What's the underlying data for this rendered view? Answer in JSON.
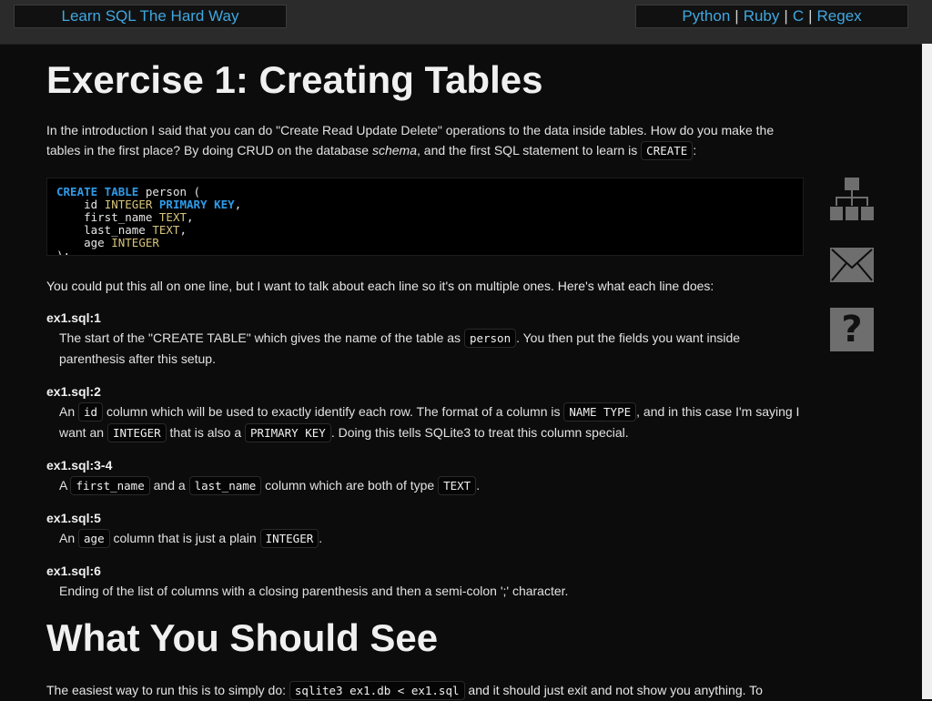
{
  "nav": {
    "title": "Learn SQL The Hard Way",
    "links": [
      "Python",
      "Ruby",
      "C",
      "Regex"
    ],
    "separator": "|"
  },
  "page": {
    "h1": "Exercise 1: Creating Tables",
    "intro_a": "In the introduction I said that you can do \"Create Read Update Delete\" operations to the data inside tables. How do you make the tables in the first place? By doing CRUD on the database ",
    "intro_em": "schema",
    "intro_b": ", and the first SQL statement to learn is ",
    "intro_code": "CREATE",
    "intro_c": ":",
    "code": {
      "l1_kw": "CREATE TABLE",
      "l1_rest": " person (",
      "l2_a": "    id ",
      "l2_ty": "INTEGER",
      "l2_kw": "PRIMARY KEY",
      "l2_end": ",",
      "l3_a": "    first_name ",
      "l3_ty": "TEXT",
      "l3_end": ",",
      "l4_a": "    last_name ",
      "l4_ty": "TEXT",
      "l4_end": ",",
      "l5_a": "    age ",
      "l5_ty": "INTEGER",
      "l6": ");"
    },
    "lead": "You could put this all on one line, but I want to talk about each line so it's on multiple ones. Here's what each line does:",
    "items": [
      {
        "term": "ex1.sql:1",
        "p1": "The start of the \"CREATE TABLE\" which gives the name of the table as ",
        "c1": "person",
        "p2": ". You then put the fields you want inside parenthesis after this setup."
      },
      {
        "term": "ex1.sql:2",
        "p1": "An ",
        "c1": "id",
        "p2": " column which will be used to exactly identify each row. The format of a column is ",
        "c2": "NAME TYPE",
        "p3": ", and in this case I'm saying I want an ",
        "c3": "INTEGER",
        "p4": " that is also a ",
        "c4": "PRIMARY KEY",
        "p5": ". Doing this tells SQLite3 to treat this column special."
      },
      {
        "term": "ex1.sql:3-4",
        "p1": "A ",
        "c1": "first_name",
        "p2": " and a ",
        "c2": "last_name",
        "p3": " column which are both of type ",
        "c3": "TEXT",
        "p4": "."
      },
      {
        "term": "ex1.sql:5",
        "p1": "An ",
        "c1": "age",
        "p2": " column that is just a plain ",
        "c2": "INTEGER",
        "p3": "."
      },
      {
        "term": "ex1.sql:6",
        "p1": "Ending of the list of columns with a closing parenthesis and then a semi-colon ';' character."
      }
    ],
    "h2": "What You Should See",
    "bottom_a": "The easiest way to run this is to simply do: ",
    "bottom_code1": "sqlite3 ex1.db < ex1.sql",
    "bottom_b": " and it should just exit and not show you anything. To"
  },
  "sidebar": {
    "icons": [
      "sitemap-icon",
      "mail-icon",
      "help-icon"
    ],
    "help_glyph": "?"
  },
  "colors": {
    "background": "#0c0c0c",
    "link": "#3fa7e0",
    "keyword": "#2e9be8",
    "type": "#d7c47a"
  }
}
